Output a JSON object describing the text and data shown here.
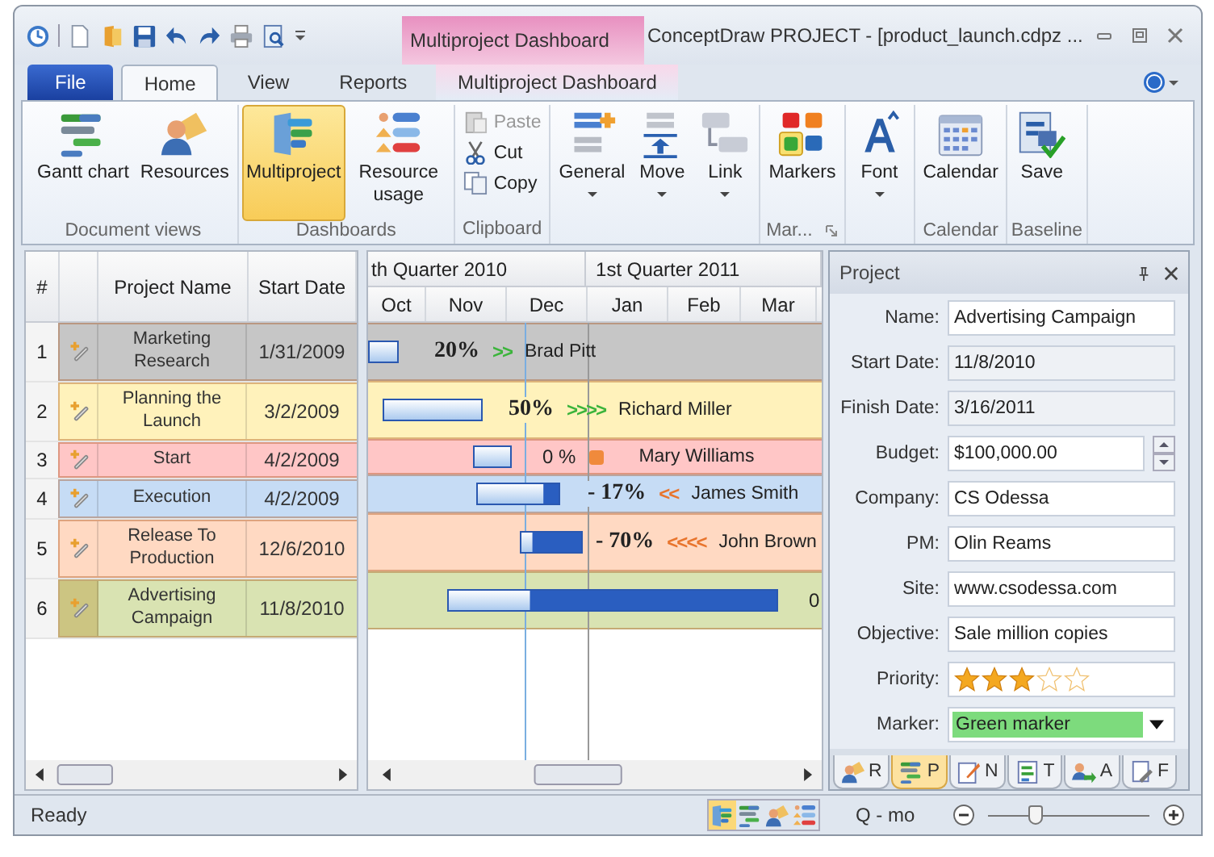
{
  "window": {
    "title": "ConceptDraw PROJECT - [product_launch.cdpz ..."
  },
  "context_group": {
    "title": "Multiproject Dashboard"
  },
  "tabs": [
    {
      "label": "File",
      "kind": "file",
      "selected": false
    },
    {
      "label": "Home",
      "kind": "normal",
      "selected": true
    },
    {
      "label": "View",
      "kind": "normal",
      "selected": false
    },
    {
      "label": "Reports",
      "kind": "normal",
      "selected": false
    },
    {
      "label": "Multiproject Dashboard",
      "kind": "context",
      "selected": false
    }
  ],
  "ribbon": {
    "groups": [
      {
        "label": "Document views",
        "buttons": [
          {
            "label": "Gantt chart",
            "kind": "gantt",
            "selected": false,
            "dropdown": false
          },
          {
            "label": "Resources",
            "kind": "resources",
            "selected": false,
            "dropdown": false
          }
        ]
      },
      {
        "label": "Dashboards",
        "buttons": [
          {
            "label": "Multiproject",
            "kind": "multiproject",
            "selected": true,
            "dropdown": false
          },
          {
            "label": "Resource usage",
            "kind": "usage",
            "selected": false,
            "dropdown": false
          }
        ]
      },
      {
        "label": "Clipboard",
        "small_buttons": [
          {
            "label": "Paste",
            "kind": "paste",
            "disabled": true
          },
          {
            "label": "Cut",
            "kind": "cut",
            "disabled": false
          },
          {
            "label": "Copy",
            "kind": "copy",
            "disabled": false
          }
        ]
      },
      {
        "buttons": [
          {
            "label": "General",
            "kind": "general",
            "selected": false,
            "dropdown": true
          },
          {
            "label": "Move",
            "kind": "move",
            "selected": false,
            "dropdown": true
          },
          {
            "label": "Link",
            "kind": "link",
            "selected": false,
            "dropdown": true
          }
        ]
      },
      {
        "label": "Mar...",
        "launcher": true,
        "buttons": [
          {
            "label": "Markers",
            "kind": "markers",
            "selected": false,
            "dropdown": false
          }
        ]
      },
      {
        "buttons": [
          {
            "label": "Font",
            "kind": "font",
            "selected": false,
            "dropdown": true
          }
        ]
      },
      {
        "label": "Calendar",
        "buttons": [
          {
            "label": "Calendar",
            "kind": "calendar",
            "selected": false,
            "dropdown": false
          }
        ]
      },
      {
        "label": "Baseline",
        "buttons": [
          {
            "label": "Save",
            "kind": "save",
            "selected": false,
            "dropdown": false
          }
        ]
      }
    ]
  },
  "table": {
    "columns": [
      "#",
      "Project Name",
      "Start Date"
    ],
    "rows": [
      {
        "number": "1",
        "name": "Marketing Research",
        "start_date": "1/31/2009",
        "color": "#c6c6c6",
        "selected": false,
        "bar": {
          "percent": "20%",
          "percent_bold": true,
          "trend": {
            "kind": "arrows",
            "text": ">>",
            "color": "#3cb43c"
          },
          "resource": "Brad Pitt"
        }
      },
      {
        "number": "2",
        "name": "Planning the Launch",
        "start_date": "3/2/2009",
        "color": "#fff2bb",
        "selected": false,
        "bar": {
          "percent": "50%",
          "percent_bold": true,
          "trend": {
            "kind": "arrows",
            "text": ">>>>",
            "color": "#3cb43c"
          },
          "resource": "Richard Miller"
        }
      },
      {
        "number": "3",
        "name": "Start",
        "start_date": "4/2/2009",
        "color": "#ffc6c6",
        "selected": false,
        "bar": {
          "percent": "0 %",
          "percent_bold": false,
          "trend": {
            "kind": "marker",
            "color": "#f08a3c"
          },
          "resource": "Mary Williams"
        }
      },
      {
        "number": "4",
        "name": "Execution",
        "start_date": "4/2/2009",
        "color": "#c6dcf5",
        "selected": false,
        "bar": {
          "percent": "- 17%",
          "percent_bold": true,
          "trend": {
            "kind": "arrows",
            "text": "<<",
            "color": "#e8742c"
          },
          "resource": "James Smith"
        }
      },
      {
        "number": "5",
        "name": "Release To Production",
        "start_date": "12/6/2010",
        "color": "#ffd9c2",
        "selected": false,
        "bar": {
          "percent": "- 70%",
          "percent_bold": true,
          "trend": {
            "kind": "arrows",
            "text": "<<<<",
            "color": "#e8742c"
          },
          "resource": "John Brown"
        }
      },
      {
        "number": "6",
        "name": "Advertising Campaign",
        "start_date": "11/8/2010",
        "color": "#d9e3b2",
        "selected": true,
        "bar": {
          "percent": "0",
          "percent_bold": false
        }
      }
    ]
  },
  "timeline": {
    "quarters": [
      "th Quarter 2010",
      "1st Quarter 2011"
    ],
    "months": [
      "Oct",
      "Nov",
      "Dec",
      "Jan",
      "Feb",
      "Mar"
    ]
  },
  "panel": {
    "title": "Project",
    "fields": [
      {
        "label": "Name:",
        "kind": "text",
        "value": "Advertising Campaign"
      },
      {
        "label": "Start Date:",
        "kind": "readonly",
        "value": "11/8/2010"
      },
      {
        "label": "Finish Date:",
        "kind": "readonly",
        "value": "3/16/2011"
      },
      {
        "label": "Budget:",
        "kind": "spin",
        "value": "$100,000.00"
      },
      {
        "label": "Company:",
        "kind": "text",
        "value": "CS Odessa"
      },
      {
        "label": "PM:",
        "kind": "text",
        "value": "Olin Reams"
      },
      {
        "label": "Site:",
        "kind": "text",
        "value": "www.csodessa.com"
      },
      {
        "label": "Objective:",
        "kind": "text",
        "value": "Sale million copies"
      },
      {
        "label": "Priority:",
        "kind": "stars",
        "stars": 3
      },
      {
        "label": "Marker:",
        "kind": "marker",
        "value": "Green marker",
        "color": "#7ddb7d"
      }
    ],
    "tabs": [
      {
        "label": "R",
        "kind": "resources",
        "selected": false
      },
      {
        "label": "P",
        "kind": "gantt",
        "selected": true
      },
      {
        "label": "N",
        "kind": "note",
        "selected": false
      },
      {
        "label": "T",
        "kind": "task",
        "selected": false
      },
      {
        "label": "A",
        "kind": "assign",
        "selected": false
      },
      {
        "label": "F",
        "kind": "file",
        "selected": false
      }
    ]
  },
  "status_bar": {
    "text": "Ready",
    "views": [
      {
        "kind": "multiproject",
        "selected": true
      },
      {
        "kind": "gantt",
        "selected": false
      },
      {
        "kind": "resources",
        "selected": false
      },
      {
        "kind": "usage",
        "selected": false
      }
    ],
    "zoom_label": "Q - mo",
    "zoom": {
      "level": 0.3
    }
  }
}
